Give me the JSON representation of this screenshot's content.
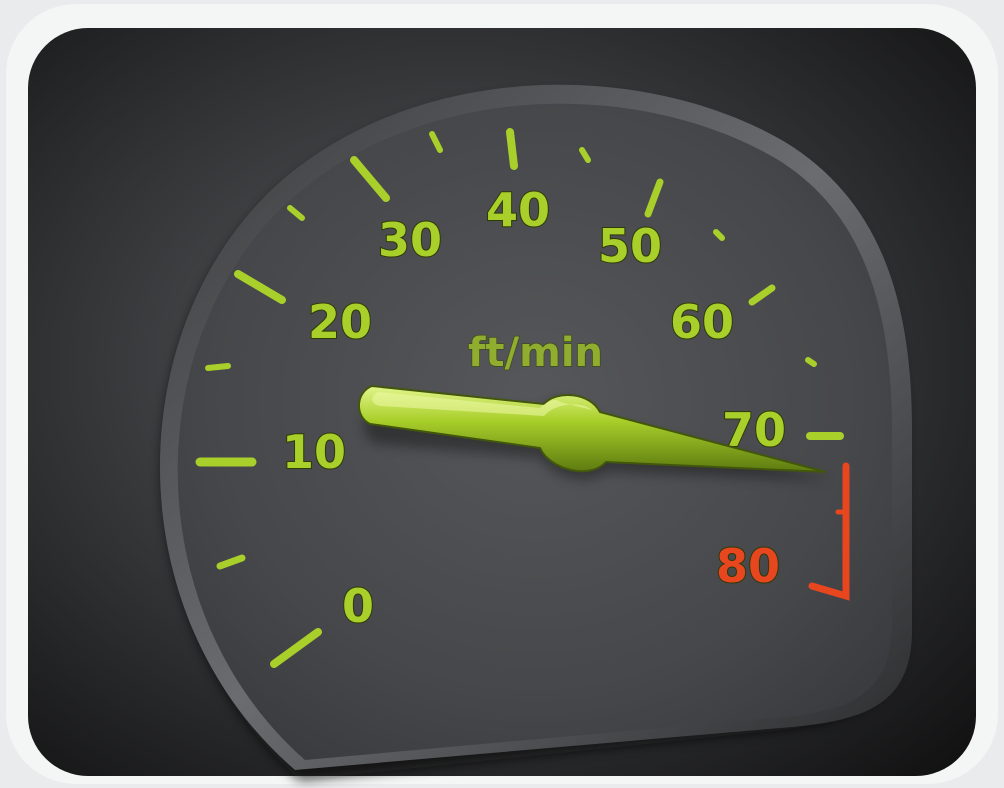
{
  "gauge": {
    "unit": "ft/min",
    "scale_labels": [
      "0",
      "10",
      "20",
      "30",
      "40",
      "50",
      "60",
      "70",
      "80"
    ],
    "redline_label": "80",
    "needle_value": 10,
    "colors": {
      "frame": "#f4f5f5",
      "background": "#2b2c2e",
      "dial": "#4a4b4e",
      "accent": "#a9cf2a",
      "redline": "#e8461f"
    }
  }
}
